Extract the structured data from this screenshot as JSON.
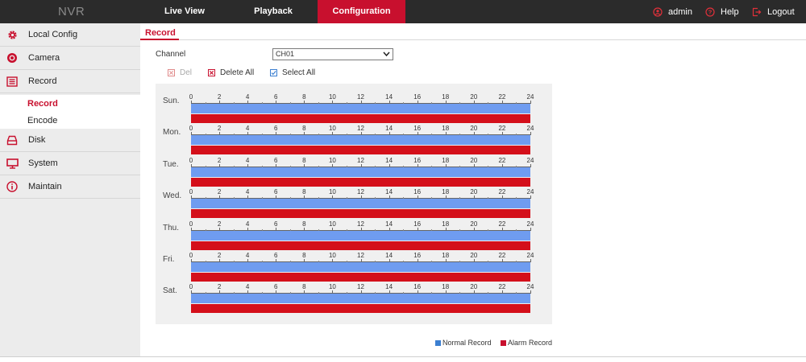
{
  "topbar": {
    "brand": "NVR",
    "tabs": [
      {
        "label": "Live View",
        "active": false
      },
      {
        "label": "Playback",
        "active": false
      },
      {
        "label": "Configuration",
        "active": true
      }
    ],
    "user": "admin",
    "help": "Help",
    "logout": "Logout"
  },
  "sidebar": {
    "items": [
      {
        "label": "Local Config",
        "icon": "gear-icon"
      },
      {
        "label": "Camera",
        "icon": "camera-icon"
      },
      {
        "label": "Record",
        "icon": "record-icon"
      },
      {
        "label": "Disk",
        "icon": "disk-icon"
      },
      {
        "label": "System",
        "icon": "monitor-icon"
      },
      {
        "label": "Maintain",
        "icon": "info-icon"
      }
    ],
    "sub_items": [
      {
        "label": "Record",
        "active": true
      },
      {
        "label": "Encode",
        "active": false
      }
    ]
  },
  "main": {
    "title": "Record",
    "channel_label": "Channel",
    "channel_value": "CH01",
    "actions": {
      "del": "Del",
      "delete_all": "Delete All",
      "select_all": "Select All"
    },
    "schedule": {
      "days": [
        "Sun.",
        "Mon.",
        "Tue.",
        "Wed.",
        "Thu.",
        "Fri.",
        "Sat."
      ],
      "hour_labels": [
        "0",
        "2",
        "4",
        "6",
        "8",
        "10",
        "12",
        "14",
        "16",
        "18",
        "20",
        "22",
        "24"
      ],
      "normal_record_hours": [
        0,
        24
      ],
      "alarm_record_hours": [
        0,
        24
      ]
    },
    "legend": {
      "normal": "Normal Record",
      "alarm": "Alarm Record"
    }
  },
  "colors": {
    "accent": "#c8102e",
    "topbar": "#2b2b2b",
    "normal_record": "#6f9cf0",
    "alarm_record": "#d40f1a",
    "sidebar_bg": "#ececec"
  }
}
